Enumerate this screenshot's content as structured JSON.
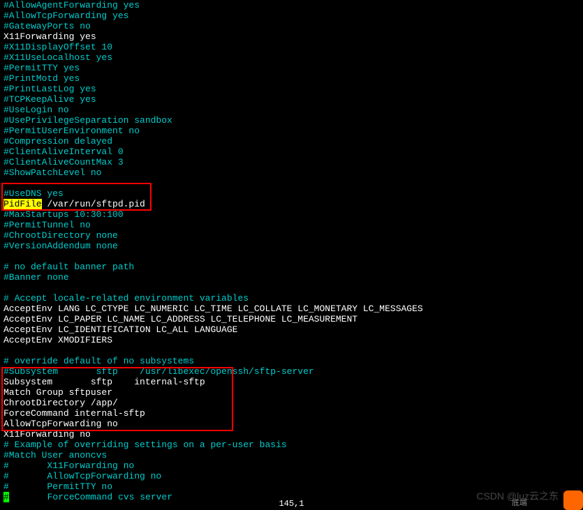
{
  "lines": [
    {
      "text": "#AllowAgentForwarding yes",
      "cls": "comment"
    },
    {
      "text": "#AllowTcpForwarding yes",
      "cls": "comment"
    },
    {
      "text": "#GatewayPorts no",
      "cls": "comment"
    },
    {
      "text": "X11Forwarding yes",
      "cls": "white"
    },
    {
      "text": "#X11DisplayOffset 10",
      "cls": "comment"
    },
    {
      "text": "#X11UseLocalhost yes",
      "cls": "comment"
    },
    {
      "text": "#PermitTTY yes",
      "cls": "comment"
    },
    {
      "text": "#PrintMotd yes",
      "cls": "comment"
    },
    {
      "text": "#PrintLastLog yes",
      "cls": "comment"
    },
    {
      "text": "#TCPKeepAlive yes",
      "cls": "comment"
    },
    {
      "text": "#UseLogin no",
      "cls": "comment"
    },
    {
      "text": "#UsePrivilegeSeparation sandbox",
      "cls": "comment"
    },
    {
      "text": "#PermitUserEnvironment no",
      "cls": "comment"
    },
    {
      "text": "#Compression delayed",
      "cls": "comment"
    },
    {
      "text": "#ClientAliveInterval 0",
      "cls": "comment"
    },
    {
      "text": "#ClientAliveCountMax 3",
      "cls": "comment"
    },
    {
      "text": "#ShowPatchLevel no",
      "cls": "comment"
    },
    {
      "text": "",
      "cls": "blank"
    },
    {
      "text": "#UseDNS yes",
      "cls": "comment"
    },
    {
      "type": "pidfile",
      "highlight": "PidFile",
      "rest": " /var/run/sftpd.pid"
    },
    {
      "text": "#MaxStartups 10:30:100",
      "cls": "comment"
    },
    {
      "text": "#PermitTunnel no",
      "cls": "comment"
    },
    {
      "text": "#ChrootDirectory none",
      "cls": "comment"
    },
    {
      "text": "#VersionAddendum none",
      "cls": "comment"
    },
    {
      "text": "",
      "cls": "blank"
    },
    {
      "text": "# no default banner path",
      "cls": "comment"
    },
    {
      "text": "#Banner none",
      "cls": "comment"
    },
    {
      "text": "",
      "cls": "blank"
    },
    {
      "text": "# Accept locale-related environment variables",
      "cls": "comment"
    },
    {
      "text": "AcceptEnv LANG LC_CTYPE LC_NUMERIC LC_TIME LC_COLLATE LC_MONETARY LC_MESSAGES",
      "cls": "white"
    },
    {
      "text": "AcceptEnv LC_PAPER LC_NAME LC_ADDRESS LC_TELEPHONE LC_MEASUREMENT",
      "cls": "white"
    },
    {
      "text": "AcceptEnv LC_IDENTIFICATION LC_ALL LANGUAGE",
      "cls": "white"
    },
    {
      "text": "AcceptEnv XMODIFIERS",
      "cls": "white"
    },
    {
      "text": "",
      "cls": "blank"
    },
    {
      "text": "# override default of no subsystems",
      "cls": "comment"
    },
    {
      "text": "#Subsystem       sftp    /usr/libexec/openssh/sftp-server",
      "cls": "comment"
    },
    {
      "text": "Subsystem       sftp    internal-sftp",
      "cls": "white"
    },
    {
      "text": "Match Group sftpuser",
      "cls": "white"
    },
    {
      "text": "ChrootDirectory /app/",
      "cls": "white"
    },
    {
      "text": "ForceCommand internal-sftp",
      "cls": "white"
    },
    {
      "text": "AllowTcpForwarding no",
      "cls": "white"
    },
    {
      "text": "X11Forwarding no",
      "cls": "white"
    },
    {
      "text": "# Example of overriding settings on a per-user basis",
      "cls": "comment"
    },
    {
      "text": "#Match User anoncvs",
      "cls": "comment"
    },
    {
      "text": "#       X11Forwarding no",
      "cls": "comment"
    },
    {
      "text": "#       AllowTcpForwarding no",
      "cls": "comment"
    },
    {
      "text": "#       PermitTTY no",
      "cls": "comment"
    },
    {
      "type": "lastline",
      "marker": "#",
      "rest": "       ForceCommand cvs server"
    }
  ],
  "status": {
    "position": "145,1",
    "right": "底端"
  },
  "watermark": "CSDN @luz云之东"
}
